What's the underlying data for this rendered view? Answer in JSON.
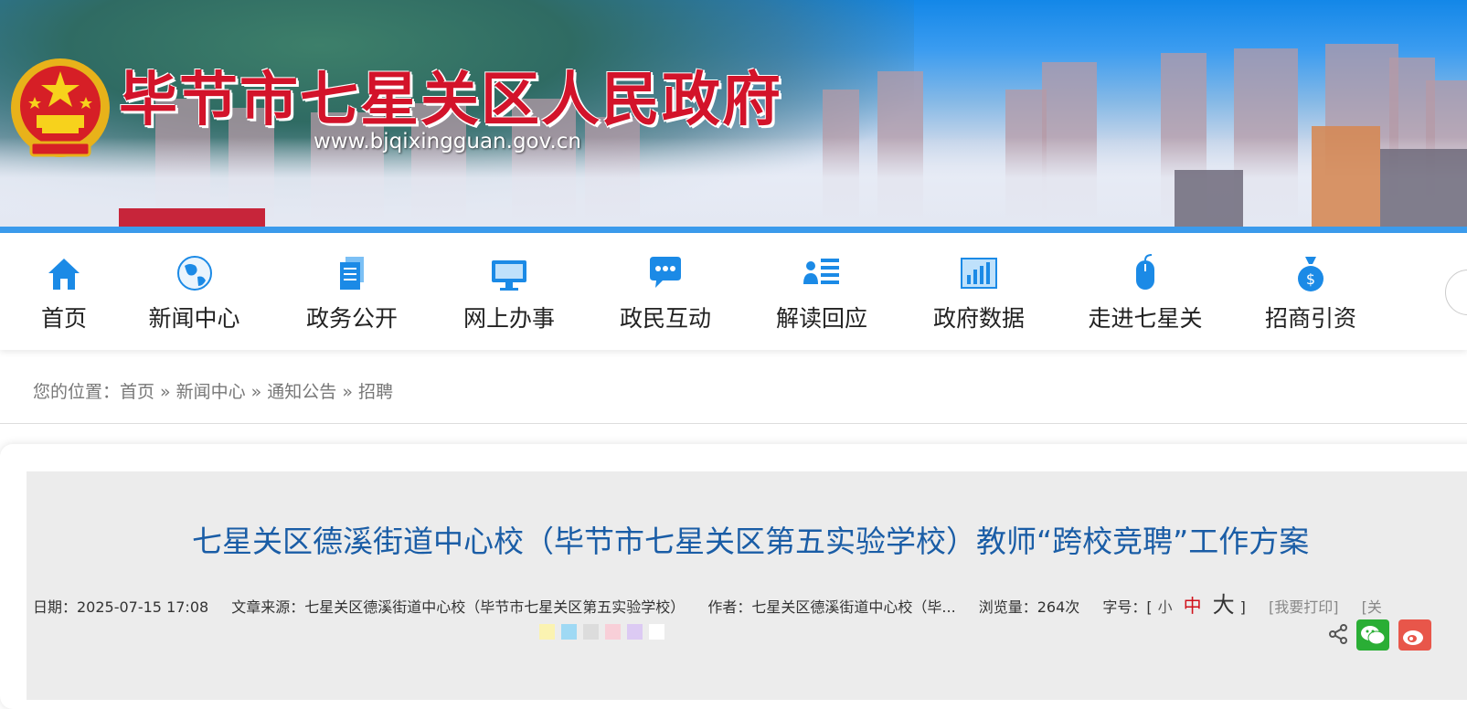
{
  "header": {
    "site_title": "毕节市七星关区人民政府",
    "site_url": "www.bjqixingguan.gov.cn"
  },
  "nav": {
    "items": [
      {
        "label": "首页",
        "icon": "home-icon"
      },
      {
        "label": "新闻中心",
        "icon": "globe-icon"
      },
      {
        "label": "政务公开",
        "icon": "document-icon"
      },
      {
        "label": "网上办事",
        "icon": "monitor-icon"
      },
      {
        "label": "政民互动",
        "icon": "chat-bubble-icon"
      },
      {
        "label": "解读回应",
        "icon": "user-list-icon"
      },
      {
        "label": "政府数据",
        "icon": "bar-chart-icon"
      },
      {
        "label": "走进七星关",
        "icon": "mouse-icon"
      },
      {
        "label": "招商引资",
        "icon": "money-bag-icon"
      }
    ]
  },
  "breadcrumb": {
    "prefix": "您的位置：",
    "items": [
      "首页",
      "新闻中心",
      "通知公告",
      "招聘"
    ],
    "separator": "»"
  },
  "article": {
    "title": "七星关区德溪街道中心校（毕节市七星关区第五实验学校）教师“跨校竞聘”工作方案",
    "date": "日期：2025-07-15 17:08",
    "source": "文章来源：七星关区德溪街道中心校（毕节市七星关区第五实验学校）",
    "author": "作者：七星关区德溪街道中心校（毕...",
    "views": "浏览量：264次",
    "font_size_label": "字号：[",
    "font_small": "小",
    "font_medium": "中",
    "font_large": "大",
    "font_close": "]",
    "print": "[我要打印]",
    "close_partial": "[关"
  },
  "colors": {
    "title_red": "#d3132a",
    "nav_icon_blue": "#1b8ae6",
    "article_title_blue": "#1a5da6",
    "swatches": [
      "#fbf3b1",
      "#9fd9f4",
      "#dcdcdc",
      "#f8cfd8",
      "#dccaf3",
      "#ffffff"
    ]
  }
}
